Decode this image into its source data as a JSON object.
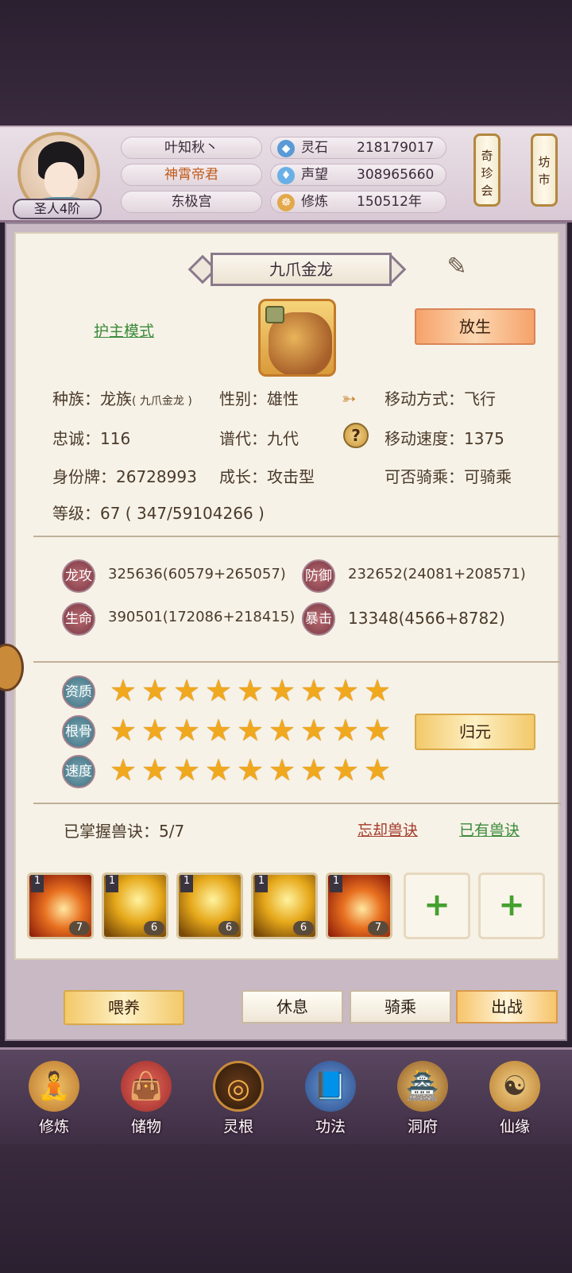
{
  "header": {
    "rank": "圣人4阶",
    "name": "叶知秋丶",
    "title": "神霄帝君",
    "sect": "东极宫",
    "stats": [
      {
        "icon": "crystal-icon",
        "label": "灵石",
        "value": "218179017"
      },
      {
        "icon": "gem-icon",
        "label": "声望",
        "value": "308965660"
      },
      {
        "icon": "meditation-icon",
        "label": "修炼",
        "value": "150512年"
      }
    ],
    "scroll_left": "奇珍会",
    "scroll_right": "坊市"
  },
  "pet": {
    "name": "九爪金龙",
    "guard_mode": "护主模式",
    "release": "放生",
    "race_label": "种族：",
    "race_value": "龙族",
    "race_sub": "( 九爪金龙 )",
    "gender": "性别：雄性",
    "move_type": "移动方式：飞行",
    "loyalty": "忠诚：116",
    "generation": "谱代：九代",
    "move_speed": "移动速度：1375",
    "id_tag": "身份牌：26728993",
    "growth": "成长：攻击型",
    "rideable": "可否骑乘：可骑乘",
    "level": "等级：67 ( 347/59104266 )"
  },
  "attrs": [
    {
      "badge": "龙攻",
      "value": "325636(60579+265057)"
    },
    {
      "badge": "防御",
      "value": "232652(24081+208571)"
    },
    {
      "badge": "生命",
      "value": "390501(172086+218415)"
    },
    {
      "badge": "暴击",
      "value": "13348(4566+8782)"
    }
  ],
  "quality": [
    {
      "label": "资质",
      "stars": 9
    },
    {
      "label": "根骨",
      "stars": 9
    },
    {
      "label": "速度",
      "stars": 9
    }
  ],
  "reset_button": "归元",
  "skills": {
    "mastered": "已掌握兽诀：5/7",
    "forget": "忘却兽诀",
    "owned": "已有兽诀",
    "items": [
      {
        "level": "1",
        "count": "7"
      },
      {
        "level": "1",
        "count": "6"
      },
      {
        "level": "1",
        "count": "6"
      },
      {
        "level": "1",
        "count": "6"
      },
      {
        "level": "1",
        "count": "7"
      }
    ],
    "empty_slot": "+"
  },
  "actions": {
    "feed": "喂养",
    "rest": "休息",
    "ride": "骑乘",
    "battle": "出战"
  },
  "nav": [
    {
      "label": "修炼",
      "icon": "monk-icon"
    },
    {
      "label": "储物",
      "icon": "bag-icon"
    },
    {
      "label": "灵根",
      "icon": "swirl-icon"
    },
    {
      "label": "功法",
      "icon": "book-icon"
    },
    {
      "label": "洞府",
      "icon": "palace-icon"
    },
    {
      "label": "仙缘",
      "icon": "gourd-icon"
    }
  ]
}
